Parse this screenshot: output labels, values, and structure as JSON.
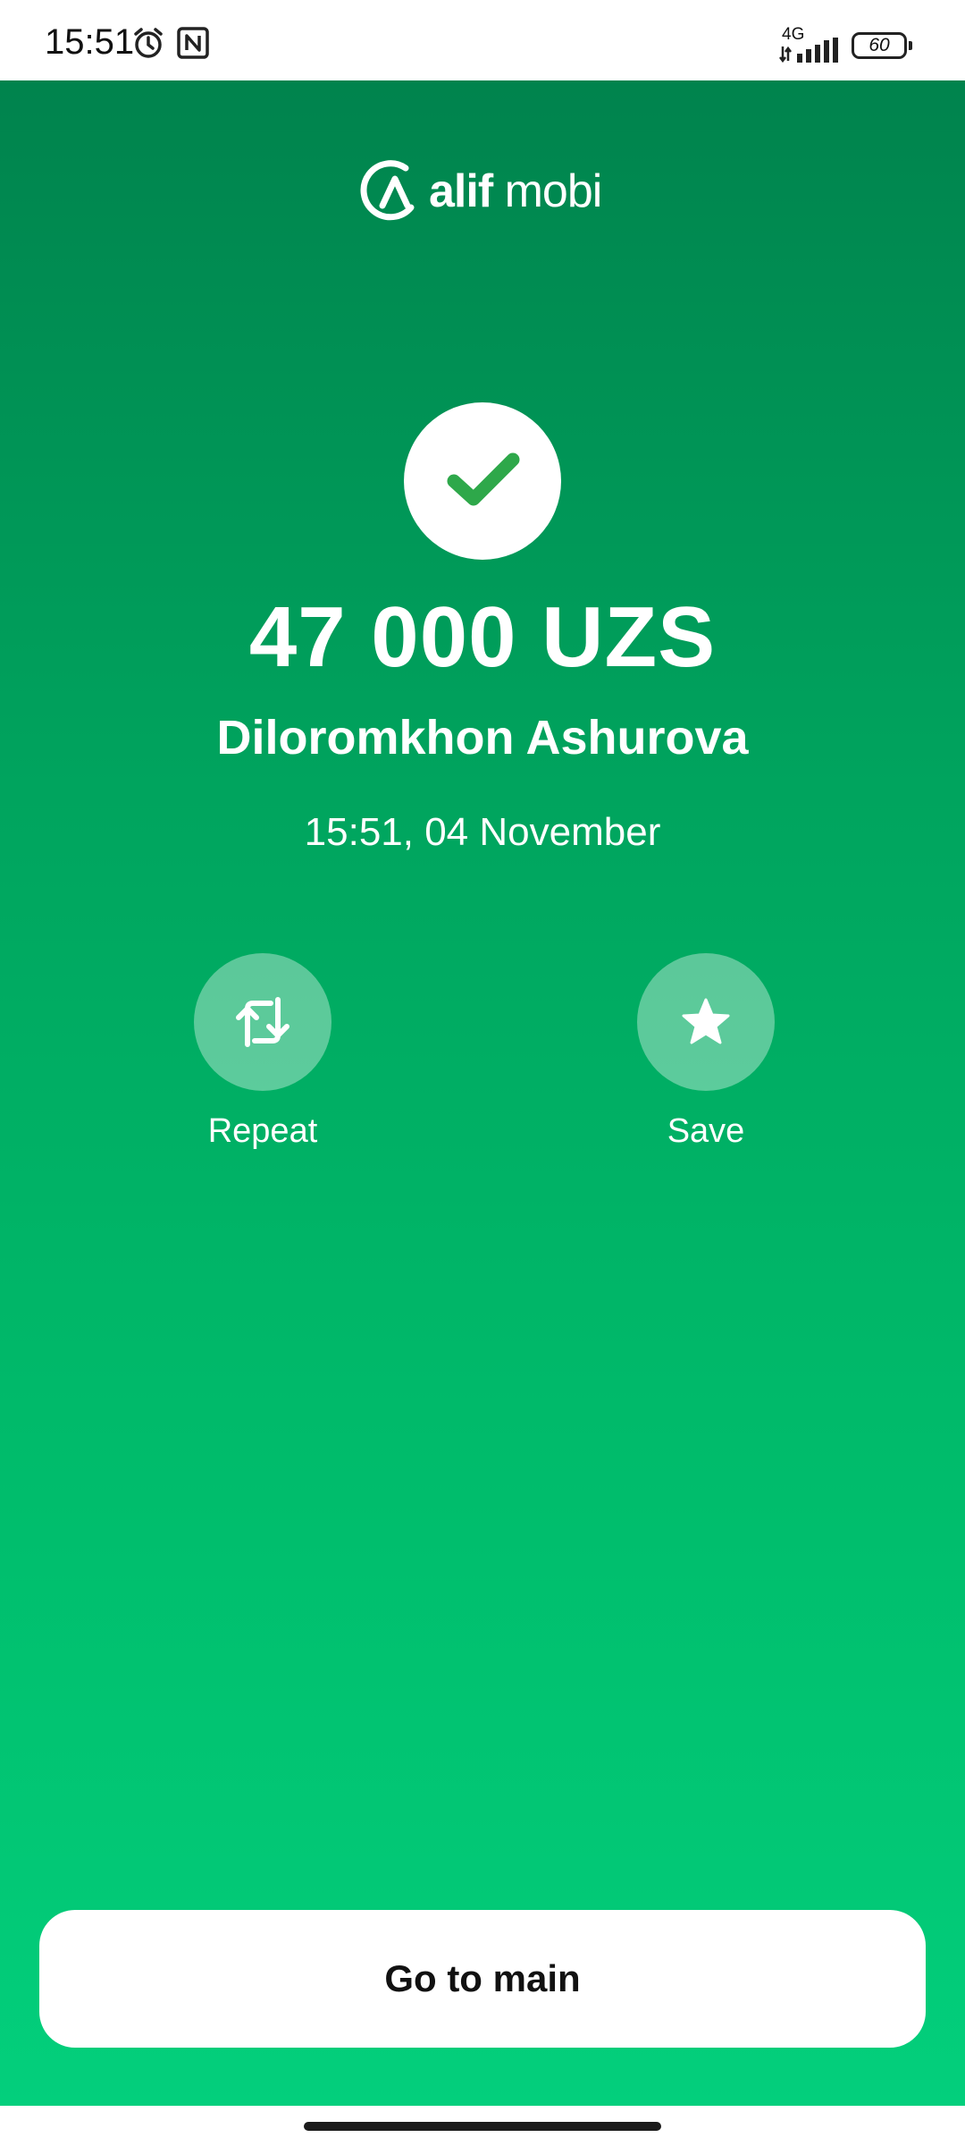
{
  "status_bar": {
    "time": "15:51",
    "network_type": "4G",
    "battery_level": "60"
  },
  "logo": {
    "brand_bold": "alif",
    "brand_light": " mobi"
  },
  "transaction": {
    "amount": "47 000 UZS",
    "recipient": "Diloromkhon Ashurova",
    "datetime": "15:51, 04 November"
  },
  "actions": {
    "repeat_label": "Repeat",
    "save_label": "Save"
  },
  "footer": {
    "go_main_label": "Go to main"
  },
  "colors": {
    "gradient_top": "#00834d",
    "gradient_bottom": "#03cf7c",
    "check_green": "#2ea84a",
    "white": "#ffffff"
  }
}
